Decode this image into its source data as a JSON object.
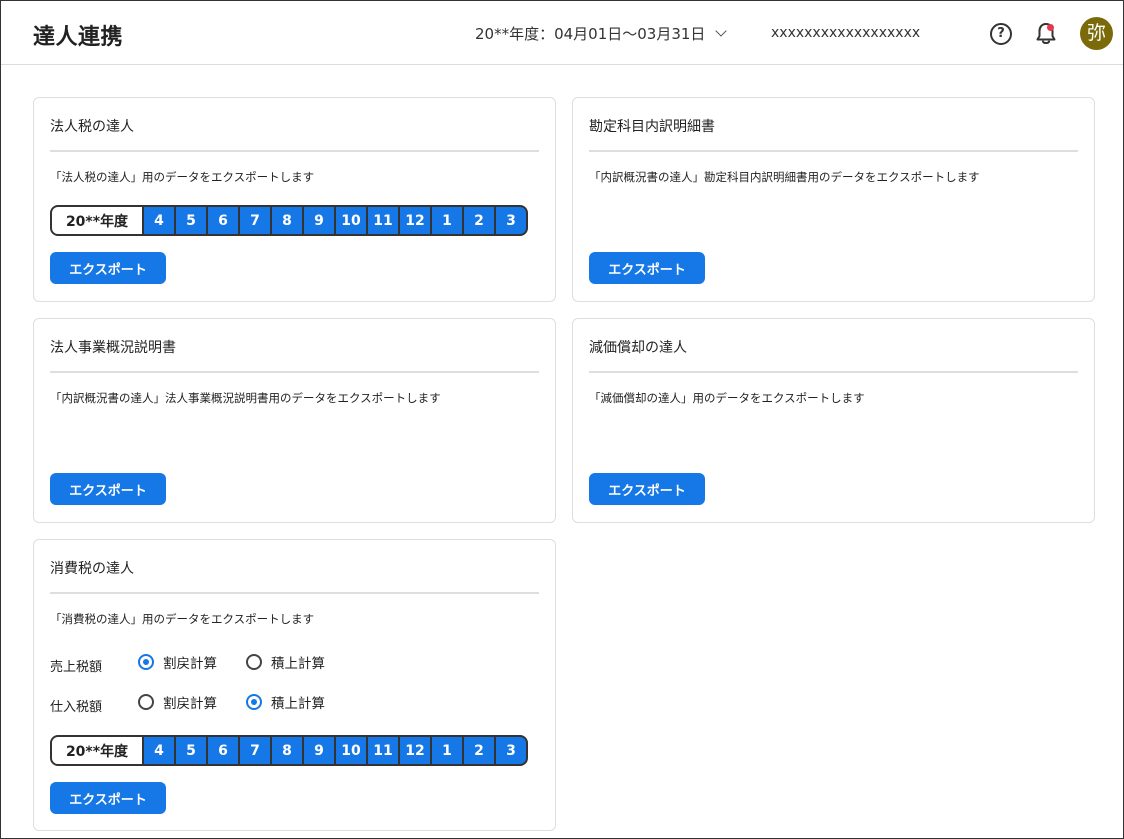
{
  "header": {
    "title": "達人連携",
    "fiscal_period": "20**年度：04月01日〜03月31日",
    "company": "xxxxxxxxxxxxxxxxxx",
    "help_glyph": "?",
    "avatar_text": "弥",
    "notification_dot_color": "#e53950"
  },
  "cards": {
    "houjinzei": {
      "title": "法人税の達人",
      "description": "「法人税の達人」用のデータをエクスポートします",
      "year": "20**年度",
      "months": [
        "4",
        "5",
        "6",
        "7",
        "8",
        "9",
        "10",
        "11",
        "12",
        "1",
        "2",
        "3"
      ],
      "button": "エクスポート"
    },
    "kanjou": {
      "title": "勘定科目内訳明細書",
      "description": "「内訳概況書の達人」勘定科目内訳明細書用のデータをエクスポートします",
      "button": "エクスポート"
    },
    "jigyou": {
      "title": "法人事業概況説明書",
      "description": "「内訳概況書の達人」法人事業概況説明書用のデータをエクスポートします",
      "button": "エクスポート"
    },
    "genka": {
      "title": "減価償却の達人",
      "description": "「減価償却の達人」用のデータをエクスポートします",
      "button": "エクスポート"
    },
    "shouhizei": {
      "title": "消費税の達人",
      "description": "「消費税の達人」用のデータをエクスポートします",
      "sales_label": "売上税額",
      "purchase_label": "仕入税額",
      "option_warimodoshi": "割戻計算",
      "option_tsumiage": "積上計算",
      "sales_selected": "割戻計算",
      "purchase_selected": "積上計算",
      "year": "20**年度",
      "months": [
        "4",
        "5",
        "6",
        "7",
        "8",
        "9",
        "10",
        "11",
        "12",
        "1",
        "2",
        "3"
      ],
      "button": "エクスポート"
    }
  },
  "colors": {
    "accent": "#1677e6",
    "avatar_bg": "#7a6a0a"
  }
}
